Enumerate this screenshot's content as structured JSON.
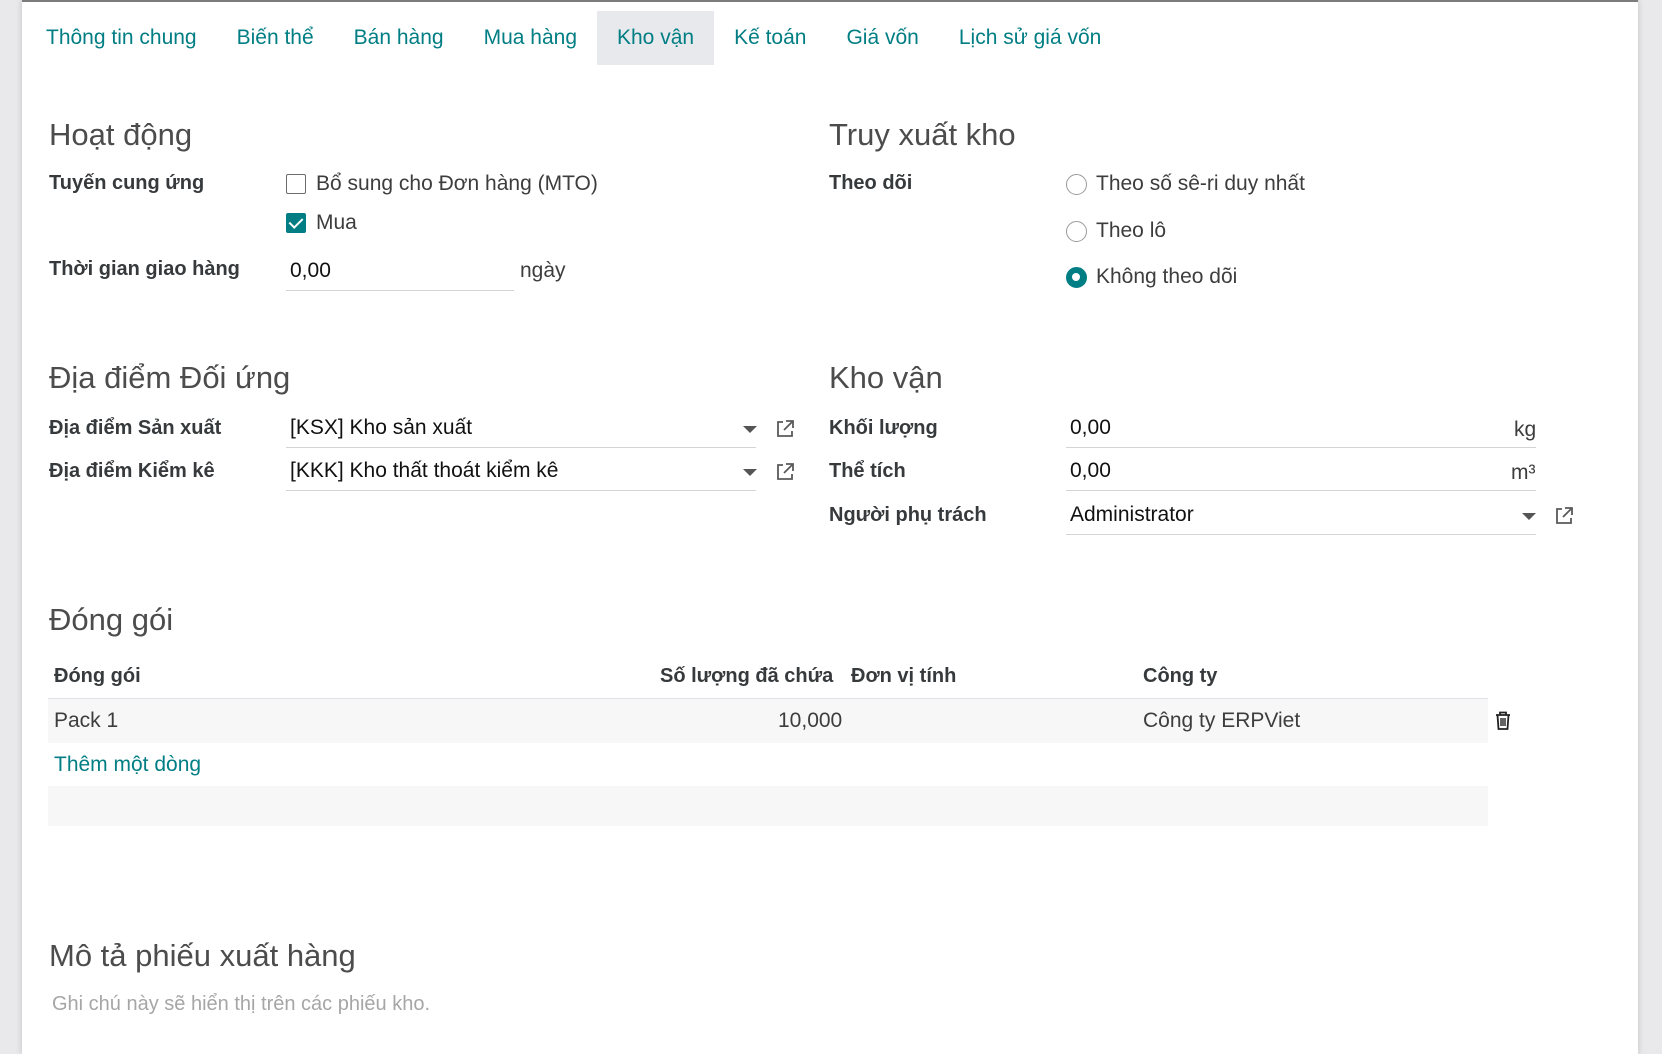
{
  "tabs": [
    {
      "label": "Thông tin chung"
    },
    {
      "label": "Biến thể"
    },
    {
      "label": "Bán hàng"
    },
    {
      "label": "Mua hàng"
    },
    {
      "label": "Kho vận",
      "active": true
    },
    {
      "label": "Kế toán"
    },
    {
      "label": "Giá vốn"
    },
    {
      "label": "Lịch sử giá vốn"
    }
  ],
  "operations": {
    "title": "Hoạt động",
    "routes_label": "Tuyến cung ứng",
    "routes": [
      {
        "label": "Bổ sung cho Đơn hàng (MTO)",
        "checked": false
      },
      {
        "label": "Mua",
        "checked": true
      }
    ],
    "lead_time_label": "Thời gian giao hàng",
    "lead_time_value": "0,00",
    "lead_time_unit": "ngày"
  },
  "traceability": {
    "title": "Truy xuất kho",
    "tracking_label": "Theo dõi",
    "options": [
      {
        "label": "Theo số sê-ri duy nhất",
        "selected": false
      },
      {
        "label": "Theo lô",
        "selected": false
      },
      {
        "label": "Không theo dõi",
        "selected": true
      }
    ]
  },
  "counterpart": {
    "title": "Địa điểm Đối ứng",
    "production_label": "Địa điểm Sản xuất",
    "production_value": "[KSX] Kho sản xuất",
    "inventory_label": "Địa điểm Kiểm kê",
    "inventory_value": "[KKK] Kho thất thoát kiểm kê"
  },
  "logistics": {
    "title": "Kho vận",
    "weight_label": "Khối lượng",
    "weight_value": "0,00",
    "weight_unit": "kg",
    "volume_label": "Thể tích",
    "volume_value": "0,00",
    "volume_unit": "m³",
    "responsible_label": "Người phụ trách",
    "responsible_value": "Administrator"
  },
  "packaging": {
    "title": "Đóng gói",
    "columns": [
      "Đóng gói",
      "Số lượng đã chứa",
      "Đơn vị tính",
      "Công ty"
    ],
    "rows": [
      {
        "name": "Pack 1",
        "qty": "10,000",
        "uom": "",
        "company": "Công ty ERPViet"
      }
    ],
    "add_line": "Thêm một dòng"
  },
  "delivery_desc": {
    "title": "Mô tả phiếu xuất hàng",
    "placeholder": "Ghi chú này sẽ hiển thị trên các phiếu kho."
  },
  "colors": {
    "accent": "#017e84",
    "active_tab_bg": "#e7e9ed"
  }
}
